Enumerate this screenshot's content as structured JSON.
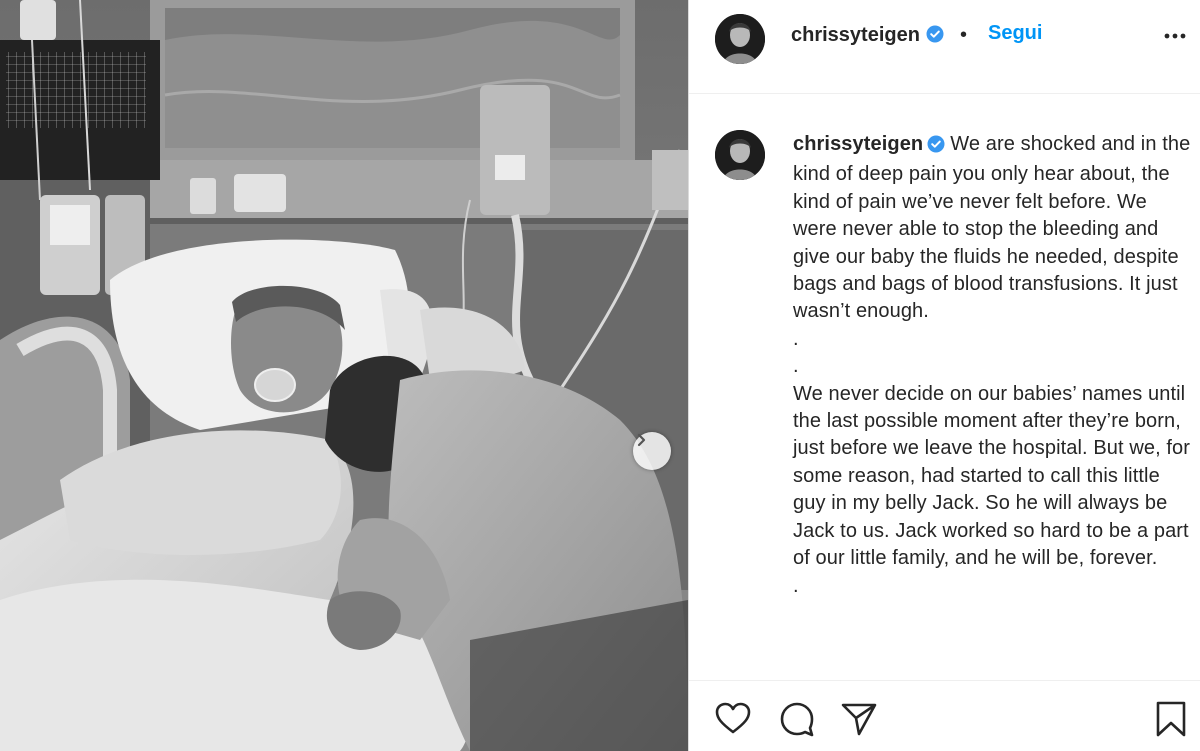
{
  "post": {
    "photo_description": "",
    "next_icon": "chevron-right-icon"
  },
  "header": {
    "username": "chrissyteigen",
    "verified_icon": "verified-badge-icon",
    "separator": "•",
    "follow_label": "Segui",
    "more_icon": "more-options-icon"
  },
  "caption": {
    "username": "chrissyteigen",
    "paragraph1": "We are shocked and in the kind of deep pain you only hear about, the kind of pain we’ve never felt before. We were never able to stop the bleeding and give our baby the fluids he needed, despite bags and bags of blood transfusions. It just wasn’t enough.",
    "dot1": ".",
    "dot2": ".",
    "paragraph2": "We never decide on our babies’ names until the last possible moment after they’re born, just before we leave the hospital.  But we, for some reason, had started to call this little guy in my belly Jack.  So he will always be Jack to us.  Jack worked so hard to be a part of our little family, and he will be, forever.",
    "dot3": "."
  },
  "actions": {
    "like_icon": "heart-icon",
    "comment_icon": "comment-icon",
    "share_icon": "paper-plane-icon",
    "save_icon": "bookmark-icon"
  },
  "colors": {
    "link_blue": "#0095f6",
    "text": "#262626",
    "divider": "#efefef"
  }
}
